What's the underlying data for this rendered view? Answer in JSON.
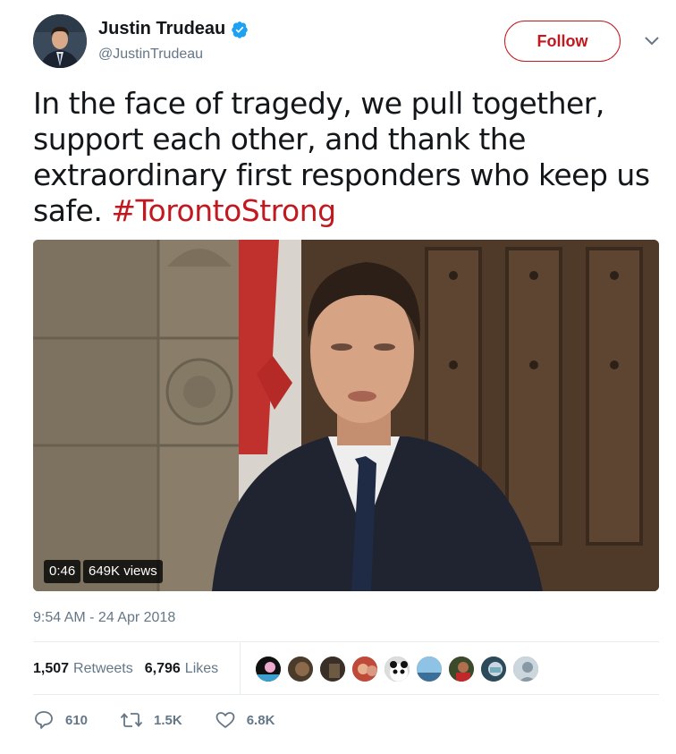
{
  "author": {
    "display_name": "Justin Trudeau",
    "handle": "@JustinTrudeau",
    "verified_icon": "verified-badge",
    "avatar_alt": "profile photo"
  },
  "follow_label": "Follow",
  "tweet": {
    "text": "In the face of tragedy, we pull together, support each other, and thank the extraordinary first responders who keep us safe. ",
    "hashtag": "#TorontoStrong"
  },
  "video": {
    "duration": "0:46",
    "views": "649K views"
  },
  "timestamp": "9:54 AM - 24 Apr 2018",
  "stats": {
    "retweets_count": "1,507",
    "retweets_label": "Retweets",
    "likes_count": "6,796",
    "likes_label": "Likes"
  },
  "likers_count_shown": 9,
  "actions": {
    "replies": "610",
    "retweets": "1.5K",
    "likes": "6.8K"
  },
  "colors": {
    "accent": "#c0191f",
    "secondary_text": "#657786",
    "verified": "#1da1f2"
  }
}
